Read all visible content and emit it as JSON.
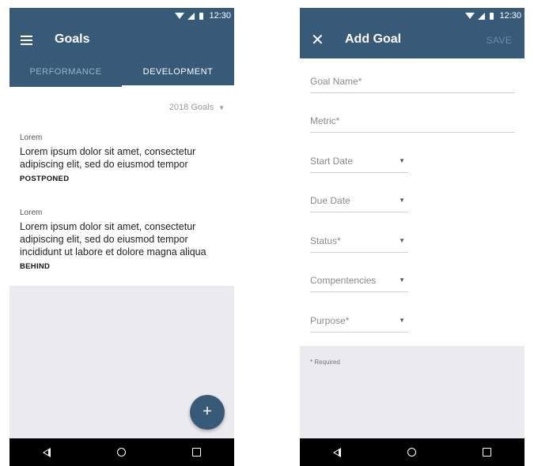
{
  "status": {
    "time": "12:30"
  },
  "left": {
    "title": "Goals",
    "tabs": [
      {
        "label": "PERFORMANCE",
        "active": false
      },
      {
        "label": "DEVELOPMENT",
        "active": true
      }
    ],
    "filter": "2018 Goals",
    "goals": [
      {
        "kicker": "Lorem",
        "desc": "Lorem ipsum dolor sit amet, consectetur adipiscing elit, sed do eiusmod tempor",
        "status": "POSTPONED"
      },
      {
        "kicker": "Lorem",
        "desc": "Lorem ipsum dolor sit amet, consectetur adipiscing elit, sed do eiusmod tempor incididunt ut labore et dolore magna aliqua",
        "status": "BEHIND"
      }
    ],
    "fab": "+"
  },
  "right": {
    "title": "Add Goal",
    "save_label": "SAVE",
    "fields": {
      "goal_name": "Goal Name*",
      "metric": "Metric*",
      "start_date": "Start Date",
      "due_date": "Due Date",
      "status": "Status*",
      "competencies": "Compentencies",
      "purpose": "Purpose*"
    },
    "required_note": "* Required"
  },
  "colors": {
    "primary": "#365a78",
    "background": "#ebebef",
    "inactive_tab": "#9bb2c6"
  },
  "icons": [
    "menu-icon",
    "close-icon",
    "wifi-icon",
    "signal-icon",
    "battery-icon",
    "plus-icon",
    "back-icon",
    "home-icon",
    "recents-icon",
    "dropdown-icon"
  ]
}
